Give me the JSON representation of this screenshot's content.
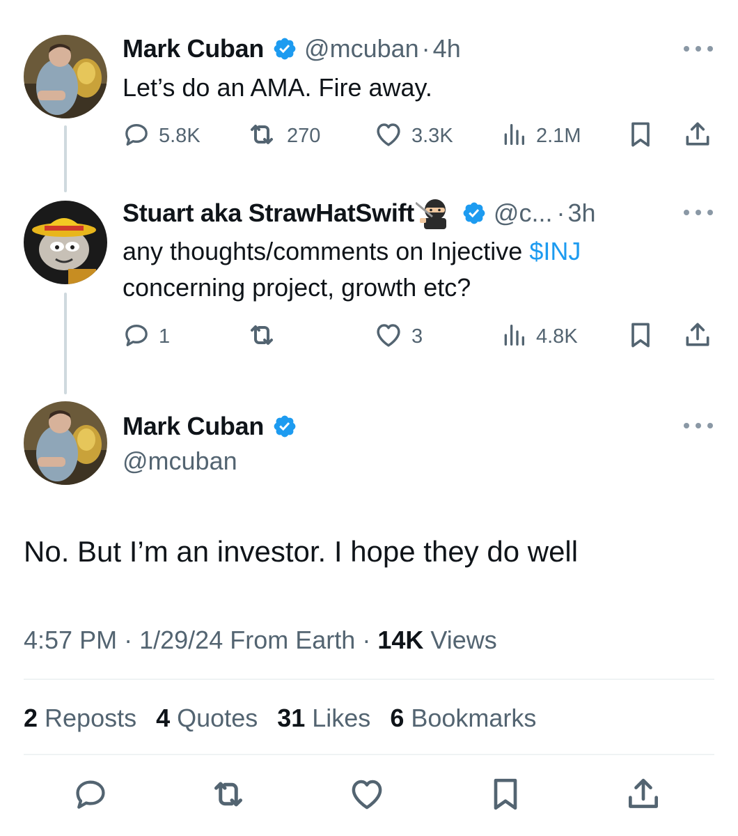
{
  "tweet1": {
    "name": "Mark Cuban",
    "handle": "@mcuban",
    "separator": "·",
    "time": "4h",
    "text": "Let’s do an AMA.  Fire away.",
    "replies": "5.8K",
    "reposts": "270",
    "likes": "3.3K",
    "views": "2.1M"
  },
  "tweet2": {
    "name": "Stuart aka StrawHatSwift",
    "handle": "@c...",
    "separator": "·",
    "time": "3h",
    "text_before": "any thoughts/comments on Injective ",
    "cashtag": "$INJ",
    "text_after": "concerning project, growth etc?",
    "replies": "1",
    "reposts": "",
    "likes": "3",
    "views": "4.8K"
  },
  "main_tweet": {
    "name": "Mark Cuban",
    "handle": "@mcuban",
    "text": "No. But I’m an investor. I hope they do well",
    "time": "4:57 PM",
    "sep1": "·",
    "date": "1/29/24",
    "source": "From Earth",
    "sep2": "·",
    "views_count": "14K",
    "views_label": "Views",
    "reposts_count": "2",
    "reposts_label": "Reposts",
    "quotes_count": "4",
    "quotes_label": "Quotes",
    "likes_count": "31",
    "likes_label": "Likes",
    "bookmarks_count": "6",
    "bookmarks_label": "Bookmarks"
  },
  "icons": {
    "verified": "verified-badge-icon",
    "reply": "reply-icon",
    "repost": "repost-icon",
    "like": "heart-icon",
    "views": "views-icon",
    "bookmark": "bookmark-icon",
    "share": "share-icon",
    "more": "more-icon",
    "ninja_emoji": "ninja-emoji-icon"
  },
  "colors": {
    "text": "#0f1419",
    "secondary": "#536471",
    "accent": "#1d9bf0",
    "verified": "#1d9bf0",
    "divider": "#eff3f4",
    "thread_line": "#cfd9de"
  }
}
